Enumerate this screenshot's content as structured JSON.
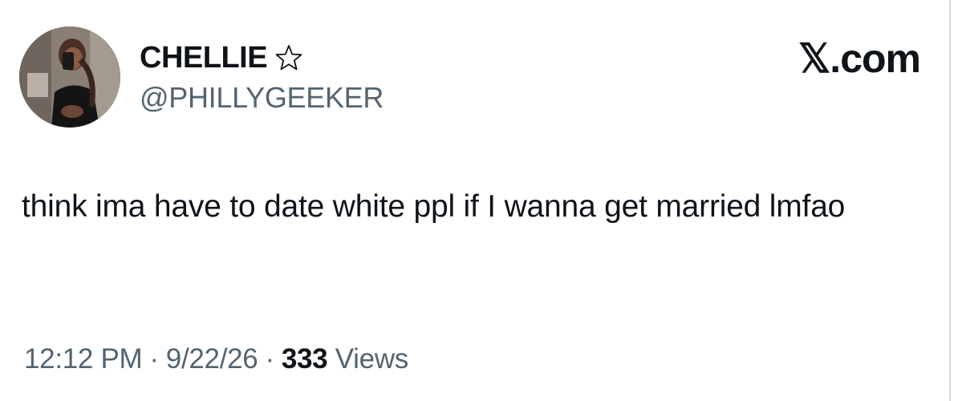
{
  "tweet": {
    "author": {
      "display_name": "CHELLIE",
      "badge_icon": "star-outline-icon",
      "handle": "@PHILLYGEEKER",
      "avatar": "profile-photo"
    },
    "brand": "𝕏.com",
    "text": "think ima have to date white ppl if I wanna get married lmfao",
    "meta": {
      "time": "12:12 PM",
      "separator": "·",
      "date": "9/22/26",
      "views_count": "333",
      "views_label": "Views"
    }
  },
  "colors": {
    "text_primary": "#0f1419",
    "text_secondary": "#536471",
    "background": "#ffffff"
  }
}
